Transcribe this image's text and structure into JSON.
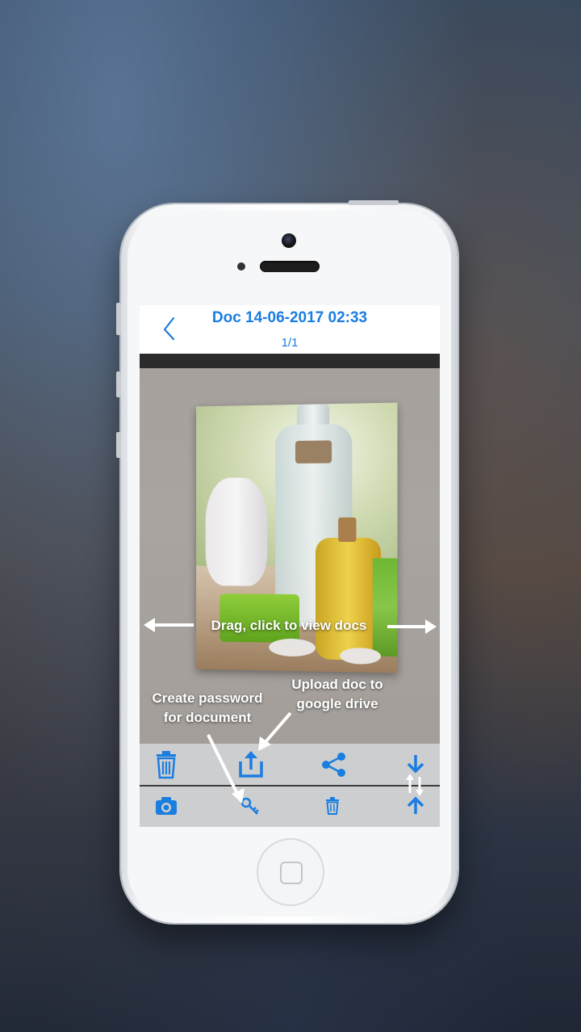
{
  "header": {
    "title": "Doc 14-06-2017 02:33",
    "page_counter": "1/1"
  },
  "hints": {
    "drag": "Drag, click to view docs",
    "password_line1": "Create password",
    "password_line2": "for document",
    "upload_line1": "Upload doc to",
    "upload_line2": "google drive"
  },
  "toolbar_top": {
    "icons": [
      "trash-icon",
      "upload-icon",
      "share-icon",
      "arrow-down-icon"
    ]
  },
  "toolbar_bottom": {
    "icons": [
      "camera-icon",
      "key-icon",
      "trash-small-icon",
      "arrow-up-icon"
    ]
  },
  "colors": {
    "accent": "#1a7de0",
    "toolbar": "#cdced0",
    "hint_text": "#ffffff"
  }
}
